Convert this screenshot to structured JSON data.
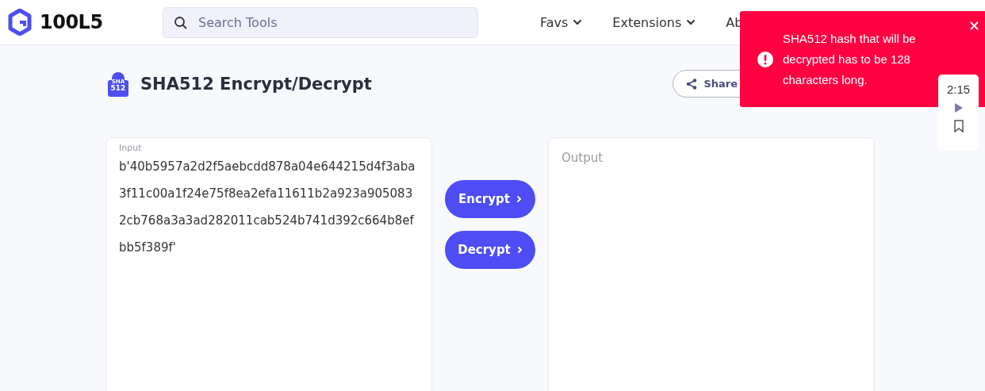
{
  "header": {
    "logo": "100L5",
    "search": {
      "placeholder": "Search Tools"
    },
    "nav": [
      {
        "label": "Favs",
        "dropdown": true
      },
      {
        "label": "Extensions",
        "dropdown": true
      },
      {
        "label": "Ab",
        "dropdown": false
      }
    ]
  },
  "tool": {
    "title": "SHA512 Encrypt/Decrypt",
    "icon_text": [
      "SHA",
      "512"
    ],
    "share": "Share"
  },
  "input": {
    "label": "Input",
    "value": "b'40b5957a2d2f5aebcdd878a04e644215d4f3aba3f11c00a1f24e75f8ea2efa11611b2a923a9050832cb768a3a3ad282011cab524b741d392c664b8efbb5f389f'"
  },
  "actions": [
    {
      "label": "Encrypt"
    },
    {
      "label": "Decrypt"
    }
  ],
  "output": {
    "placeholder": "Output"
  },
  "toast": {
    "message": "SHA512 hash that will be decrypted has to be 128 characters long."
  },
  "video_widget": {
    "time": "2:15"
  }
}
